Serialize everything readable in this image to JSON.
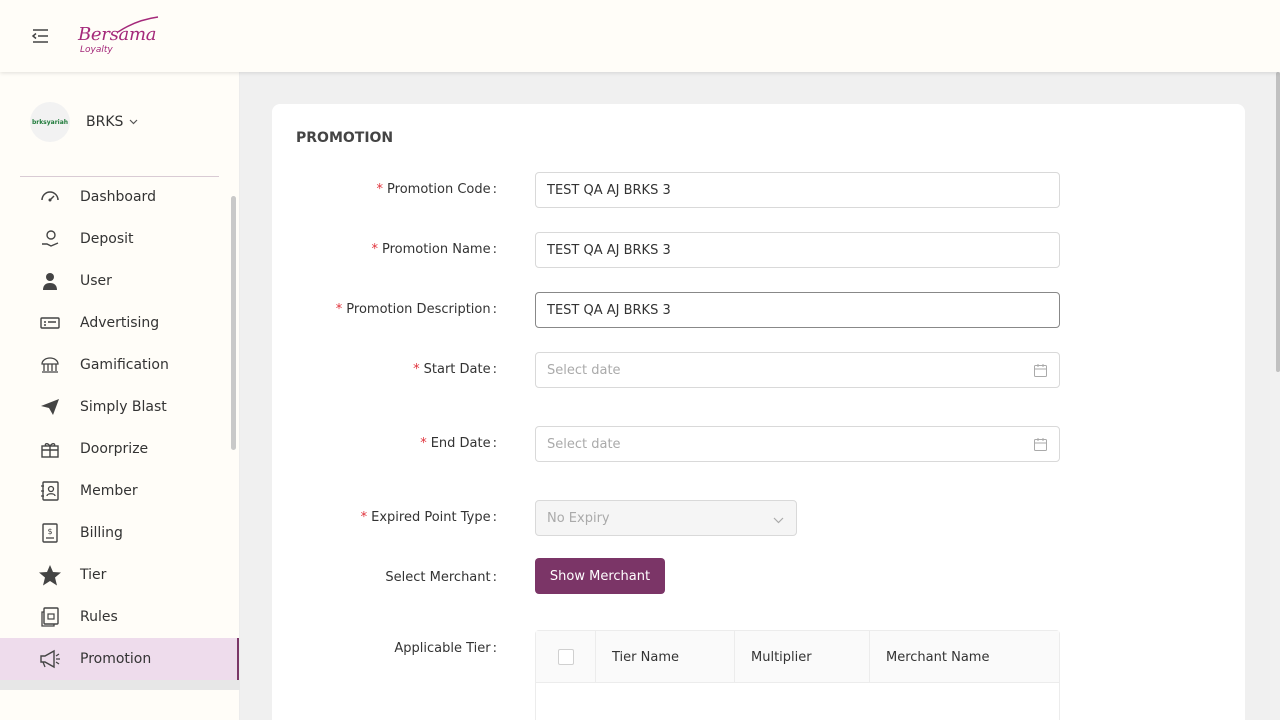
{
  "header": {
    "logo_text": "Bersama",
    "logo_sub": "Loyalty",
    "menu_icon": "menu-collapse-icon"
  },
  "sidebar": {
    "brand_logo_text": "brksyariah",
    "brand_name": "BRKS",
    "items": [
      {
        "label": "Dashboard",
        "icon": "dashboard-icon"
      },
      {
        "label": "Deposit",
        "icon": "deposit-icon"
      },
      {
        "label": "User",
        "icon": "user-icon"
      },
      {
        "label": "Advertising",
        "icon": "advertising-icon"
      },
      {
        "label": "Gamification",
        "icon": "gamification-icon"
      },
      {
        "label": "Simply Blast",
        "icon": "send-icon"
      },
      {
        "label": "Doorprize",
        "icon": "gift-icon"
      },
      {
        "label": "Member",
        "icon": "member-icon"
      },
      {
        "label": "Billing",
        "icon": "billing-icon"
      },
      {
        "label": "Tier",
        "icon": "star-icon"
      },
      {
        "label": "Rules",
        "icon": "rules-icon"
      },
      {
        "label": "Promotion",
        "icon": "megaphone-icon",
        "active": true
      }
    ]
  },
  "form": {
    "title": "PROMOTION",
    "promotion_code_label": "Promotion Code",
    "promotion_code_value": "TEST QA AJ BRKS 3",
    "promotion_name_label": "Promotion Name",
    "promotion_name_value": "TEST QA AJ BRKS 3",
    "promotion_description_label": "Promotion Description",
    "promotion_description_value": "TEST QA AJ BRKS 3",
    "start_date_label": "Start Date",
    "start_date_placeholder": "Select date",
    "end_date_label": "End Date",
    "end_date_placeholder": "Select date",
    "expired_point_type_label": "Expired Point Type",
    "expired_point_type_value": "No Expiry",
    "select_merchant_label": "Select Merchant",
    "show_merchant_button": "Show Merchant",
    "applicable_tier_label": "Applicable Tier",
    "table_columns": [
      "Tier Name",
      "Multiplier",
      "Merchant Name"
    ]
  },
  "colors": {
    "accent": "#7b3567",
    "active_bg": "#eedcec",
    "required": "#e0313a",
    "logo": "#a4287a"
  }
}
